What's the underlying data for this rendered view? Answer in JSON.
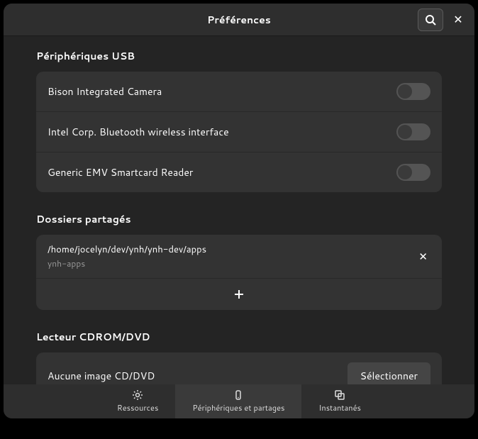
{
  "header": {
    "title": "Préférences"
  },
  "usb": {
    "title": "Périphériques USB",
    "devices": [
      {
        "label": "Bison Integrated Camera"
      },
      {
        "label": "Intel Corp. Bluetooth wireless interface"
      },
      {
        "label": "Generic EMV Smartcard Reader"
      }
    ]
  },
  "folders": {
    "title": "Dossiers partagés",
    "items": [
      {
        "path": "/home/jocelyn/dev/ynh/ynh-dev/apps",
        "name": "ynh-apps"
      }
    ]
  },
  "cdrom": {
    "title": "Lecteur CDROM/DVD",
    "empty_label": "Aucune image CD/DVD",
    "select_label": "Sélectionner"
  },
  "nav": {
    "resources": "Ressources",
    "devices": "Périphériques et partages",
    "snapshots": "Instantanés"
  }
}
